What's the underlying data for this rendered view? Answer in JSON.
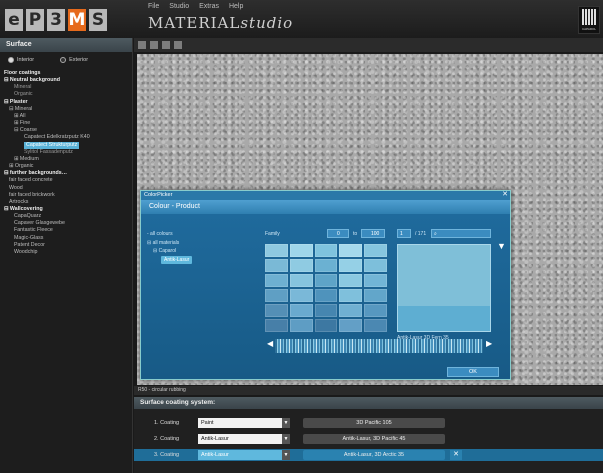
{
  "logo": {
    "letters": [
      "e",
      "P",
      "3",
      "M",
      "S"
    ]
  },
  "menu": [
    "File",
    "Studio",
    "Extras",
    "Help"
  ],
  "app_title": {
    "main": "MATERIAL",
    "italic": "studio"
  },
  "brand_label": "CAPAROL",
  "sidebar": {
    "header": "Surface",
    "radio_interior": "Interior",
    "radio_exterior": "Exterior",
    "tree": [
      {
        "text": "Floor coatings",
        "cls": "b",
        "indent": 0
      },
      {
        "text": "⊟ Neutral background",
        "cls": "b",
        "indent": 0
      },
      {
        "text": "Mineral",
        "cls": "dim",
        "indent": 10
      },
      {
        "text": "Organic",
        "cls": "dim",
        "indent": 10
      },
      {
        "text": "⊟ Plaster",
        "cls": "b",
        "indent": 0
      },
      {
        "text": "⊟ Mineral",
        "cls": "",
        "indent": 5
      },
      {
        "text": "⊞ All",
        "cls": "",
        "indent": 10
      },
      {
        "text": "⊞ Fine",
        "cls": "",
        "indent": 10
      },
      {
        "text": "⊟ Coarse",
        "cls": "",
        "indent": 10
      },
      {
        "text": "Capatect Edelkratzputz K40",
        "cls": "",
        "indent": 20
      },
      {
        "text": "Capatect Strukturputz",
        "cls": "sel",
        "indent": 20
      },
      {
        "text": "Sylitol Fassadenputz",
        "cls": "dim",
        "indent": 20
      },
      {
        "text": "⊞ Medium",
        "cls": "",
        "indent": 10
      },
      {
        "text": "⊞ Organic",
        "cls": "",
        "indent": 5
      },
      {
        "text": "⊟ further backgrounds…",
        "cls": "b",
        "indent": 0
      },
      {
        "text": "fair faced concrete",
        "cls": "",
        "indent": 5
      },
      {
        "text": "Wood",
        "cls": "",
        "indent": 5
      },
      {
        "text": "fair faced brickwork",
        "cls": "",
        "indent": 5
      },
      {
        "text": "Artrocks",
        "cls": "",
        "indent": 5
      },
      {
        "text": "⊟ Wallcovering",
        "cls": "b",
        "indent": 0
      },
      {
        "text": "CapaQuarz",
        "cls": "",
        "indent": 10
      },
      {
        "text": "Capaver Glasgewebe",
        "cls": "",
        "indent": 10
      },
      {
        "text": "Fantastic Fleece",
        "cls": "",
        "indent": 10
      },
      {
        "text": "Magic-Glass",
        "cls": "",
        "indent": 10
      },
      {
        "text": "Patent Decor",
        "cls": "",
        "indent": 10
      },
      {
        "text": "Woodchip",
        "cls": "",
        "indent": 10
      }
    ]
  },
  "status_text": "R50 - circular rubbing",
  "coating_system": {
    "header": "Surface coating system:",
    "rows": [
      {
        "label": "1. Coating",
        "type": "Paint",
        "result": "3D Pacific 105",
        "active": false
      },
      {
        "label": "2. Coating",
        "type": "Antik-Lasur",
        "result": "Antik-Lasur, 3D Pacific 45",
        "active": false
      },
      {
        "label": "3. Coating",
        "type": "Antik-Lasur",
        "result": "Antik-Lasur, 3D Arctic 35",
        "active": true
      }
    ],
    "remove_symbol": "✕",
    "dropdown_arrow": "▼"
  },
  "dialog": {
    "title": "ColorPicker",
    "close": "✕",
    "subtitle": "Colour - Product",
    "tree": [
      "- all colours",
      "⊟ all materials",
      "⊟ Caparol",
      "Antik-Lasur"
    ],
    "family_label": "Family",
    "from_value": "0",
    "to_label": "to",
    "to_value": "100",
    "page": "1",
    "page_total": "/ 171",
    "preview_caption": "Antik-Lasur 3D Fern 35",
    "ok": "OK",
    "swatches": [
      "#8fc9e0",
      "#9fd6ea",
      "#7fc3de",
      "#a5d9ec",
      "#86c6df",
      "#7ab9d6",
      "#8fcbe2",
      "#6bb1d2",
      "#95d0e6",
      "#7dbfdb",
      "#6eb0d1",
      "#86c4de",
      "#5ea4c8",
      "#8bc9e1",
      "#72b5d6",
      "#5f9fc4",
      "#7ab8d8",
      "#4f93bc",
      "#7fc0dc",
      "#62a6ca",
      "#548fb6",
      "#6aaacf",
      "#4686b0",
      "#70b0d2",
      "#5798c0",
      "#477fa8",
      "#5e9dc4",
      "#3d78a2",
      "#639fc6",
      "#4b88b2"
    ]
  },
  "colors": {
    "accent": "#e66a1c",
    "dialog": "#2e80b3",
    "selection": "#5ab3d8"
  }
}
